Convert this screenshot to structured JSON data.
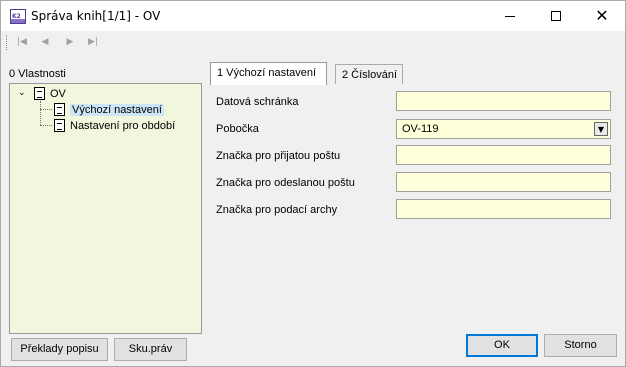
{
  "window": {
    "title": "Správa knih[1/1] - OV",
    "app_icon_text": "K2",
    "close_glyph": "✕"
  },
  "toolbar": {
    "nav": [
      {
        "name": "first-record-icon",
        "glyph": "|◀"
      },
      {
        "name": "prev-record-icon",
        "glyph": "◀"
      },
      {
        "name": "next-record-icon",
        "glyph": "▶"
      },
      {
        "name": "last-record-icon",
        "glyph": "▶|"
      }
    ]
  },
  "left_panel": {
    "title": "0 Vlastnosti",
    "tree": {
      "root_label": "OV",
      "children": [
        "Výchozí nastavení",
        "Nastavení pro období"
      ],
      "selected": "Výchozí nastavení"
    },
    "buttons": {
      "translations": "Překlady popisu",
      "rights": "Sku.práv"
    }
  },
  "tabs": [
    {
      "label": "1 Výchozí nastavení",
      "active": true
    },
    {
      "label": "2 Číslování",
      "active": false
    }
  ],
  "form": {
    "data_box_label": "Datová schránka",
    "data_box_value": "",
    "branch_label": "Pobočka",
    "branch_value": "OV-119",
    "incoming_mark_label": "Značka pro přijatou poštu",
    "incoming_mark_value": "",
    "outgoing_mark_label": "Značka pro odeslanou poštu",
    "outgoing_mark_value": "",
    "filing_sheets_label": "Značka pro podací archy",
    "filing_sheets_value": ""
  },
  "dialog_buttons": {
    "ok": "OK",
    "cancel": "Storno"
  },
  "colors": {
    "field_bg": "#ffffd9",
    "tree_bg": "#f0f7dc",
    "selection": "#cde6f7",
    "accent": "#0078d7"
  }
}
